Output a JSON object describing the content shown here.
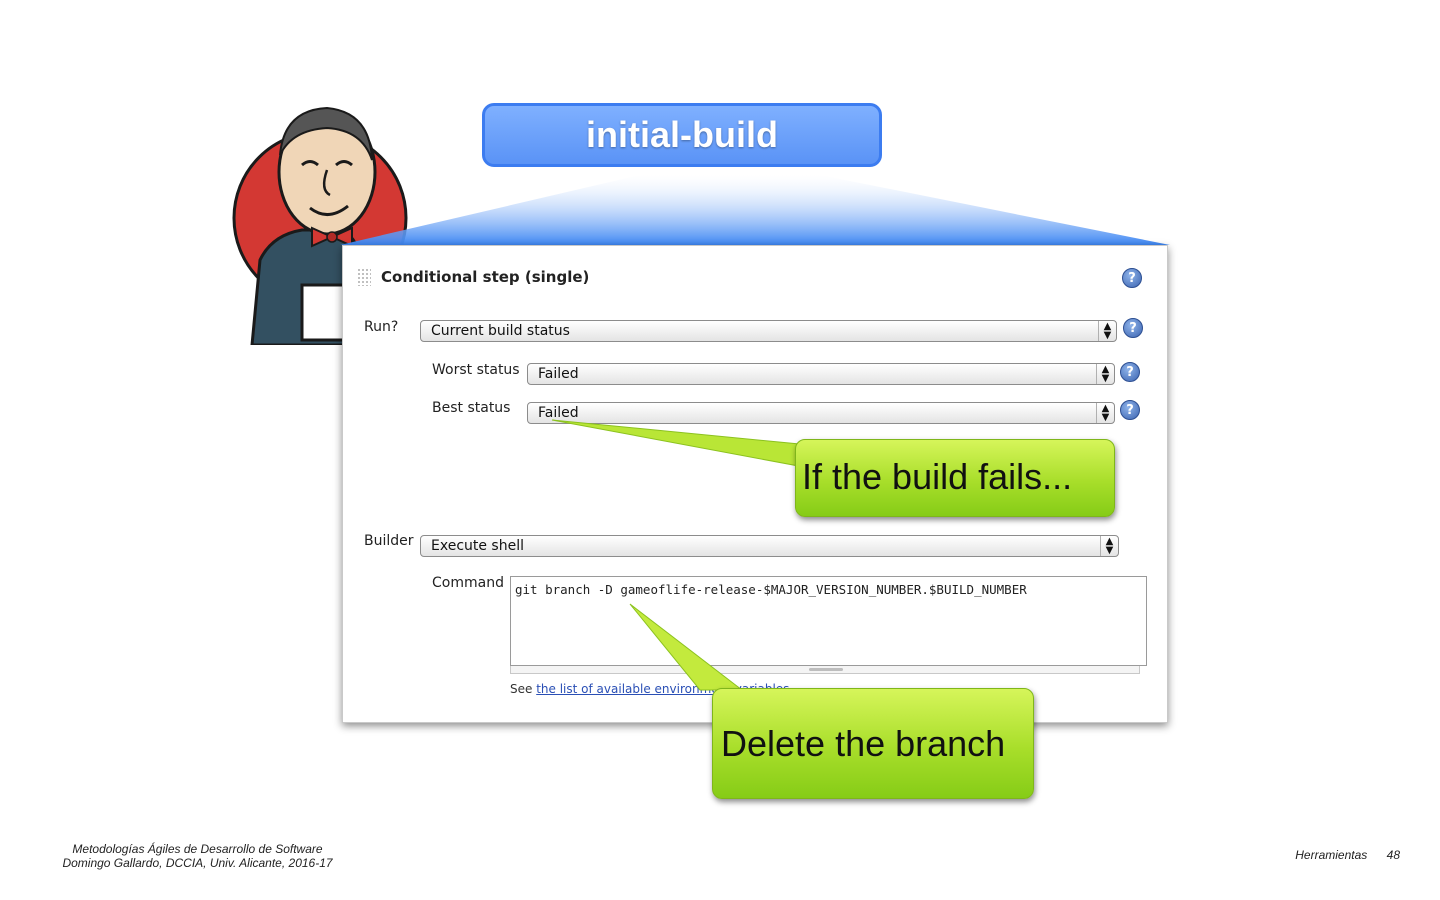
{
  "title": "initial-build",
  "panel": {
    "step_title": "Conditional step (single)",
    "run_label": "Run?",
    "run_value": "Current build status",
    "worst_status_label": "Worst status",
    "worst_status_value": "Failed",
    "best_status_label": "Best status",
    "best_status_value": "Failed",
    "builder_label": "Builder",
    "builder_value": "Execute shell",
    "command_label": "Command",
    "command_value": "git branch -D gameoflife-release-$MAJOR_VERSION_NUMBER.$BUILD_NUMBER",
    "see_prefix": "See",
    "see_link": "the list of available environment variables",
    "help_glyph": "?"
  },
  "callouts": {
    "first": "If the build fails...",
    "second": "Delete the branch"
  },
  "footer": {
    "course": "Metodologías Ágiles de Desarrollo de Software",
    "author": "Domingo Gallardo, DCCIA, Univ. Alicante, 2016-17",
    "section": "Herramientas",
    "page": "48"
  },
  "colors": {
    "title_blue": "#5a93f6",
    "callout_green": "#a8de2a",
    "help_blue": "#3b63b0"
  }
}
